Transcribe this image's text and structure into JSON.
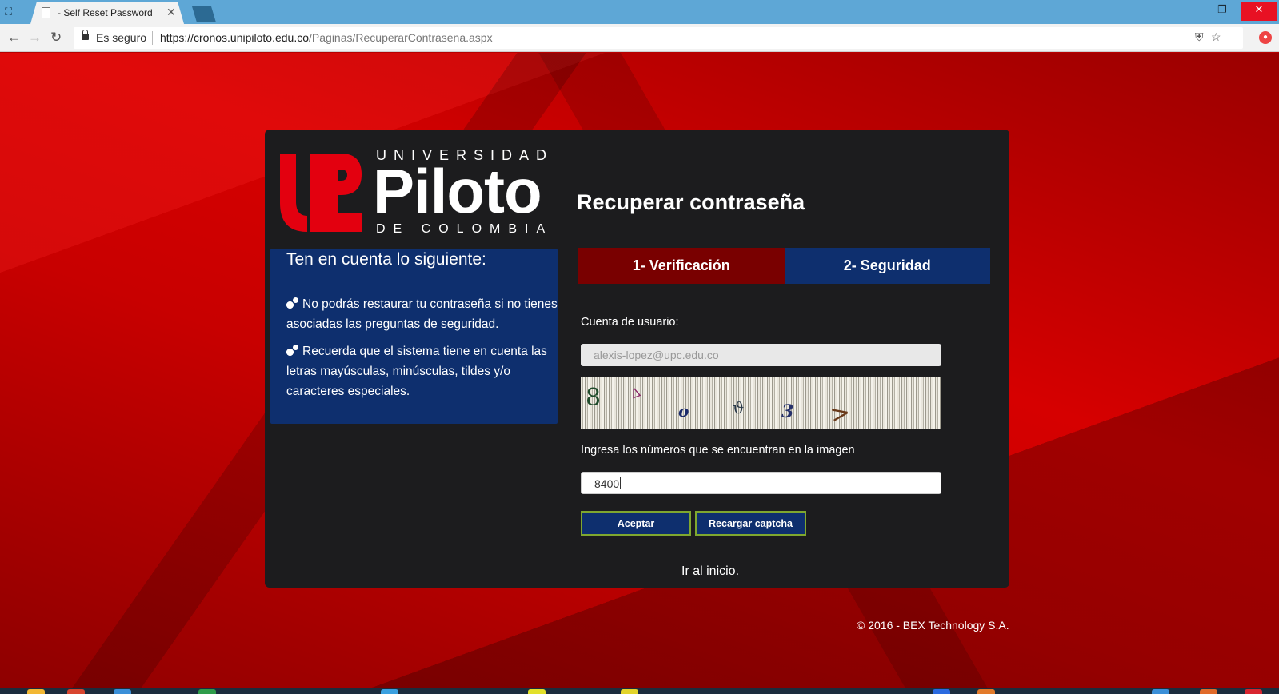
{
  "browser": {
    "tab_title": "- Self Reset Password",
    "tab_close": "✕",
    "secure_label": "Es seguro",
    "url_host": "https://cronos.unipiloto.edu.co",
    "url_path": "/Paginas/RecuperarContrasena.aspx",
    "window_controls": {
      "minimize": "–",
      "maximize": "❐",
      "close": "✕"
    },
    "nav": {
      "back": "←",
      "forward": "→",
      "reload": "↻"
    },
    "icons": {
      "bookmark": "☆",
      "shield": "⛨"
    }
  },
  "logo": {
    "top_text": "UNIVERSIDAD",
    "main_text": "Piloto",
    "bottom_text": "DE COLOMBIA",
    "mark_color": "#e3000f"
  },
  "page_title": "Recuperar contraseña",
  "info": {
    "heading": "Ten en cuenta lo siguiente:",
    "items": [
      "No podrás restaurar tu contraseña si no tienes asociadas las preguntas de seguridad.",
      "Recuerda que el sistema tiene en cuenta las letras mayúsculas, minúsculas, tildes y/o caracteres especiales."
    ]
  },
  "steps": [
    {
      "label": "1- Verificación",
      "active": true
    },
    {
      "label": "2- Seguridad",
      "active": false
    }
  ],
  "form": {
    "account_label": "Cuenta de usuario:",
    "account_value": "alexis-lopez@upc.edu.co",
    "captcha_label": "Ingresa los números que se encuentran en la imagen",
    "captcha_value": "8400",
    "captcha_chars": [
      "8",
      "ᐃ",
      "o",
      "ϑ",
      "3",
      ">"
    ],
    "accept_button": "Aceptar",
    "reload_button": "Recargar captcha"
  },
  "home_link": "Ir al inicio.",
  "footer": "© 2016 - BEX Technology S.A.",
  "colors": {
    "primary_blue": "#0e2f6e",
    "active_step": "#790000",
    "card_bg": "#1c1c1e",
    "button_border": "#7fa72f",
    "background_red": "#c80000"
  }
}
